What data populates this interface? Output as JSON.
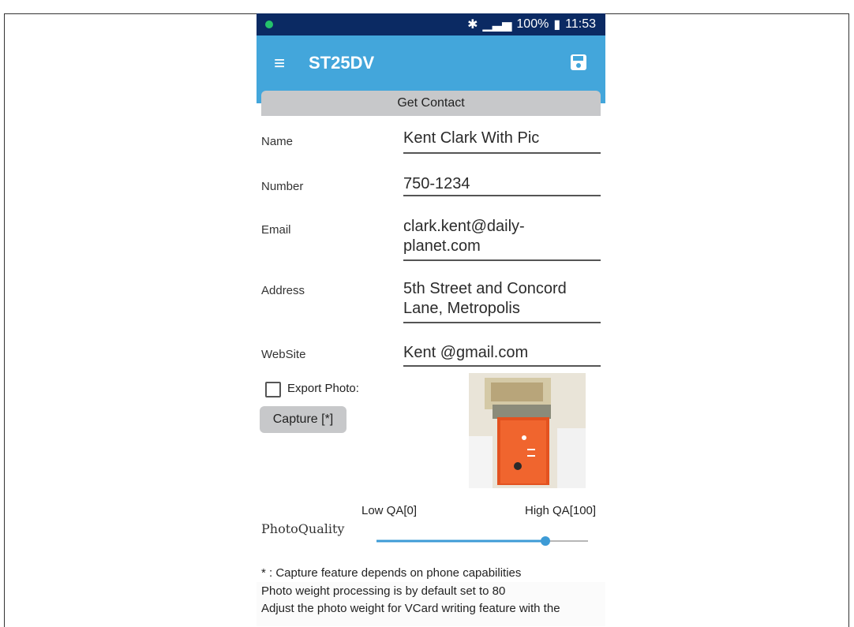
{
  "status_bar": {
    "battery": "100%",
    "time": "11:53"
  },
  "appbar": {
    "title": "ST25DV"
  },
  "get_contact_label": "Get Contact",
  "form": {
    "name_label": "Name",
    "name_value": "Kent Clark With Pic",
    "number_label": "Number",
    "number_value": "750-1234",
    "email_label": "Email",
    "email_value_line1": "clark.kent@daily-",
    "email_value_line2": "planet.com",
    "address_label": "Address",
    "address_value_line1": "5th Street and Concord",
    "address_value_line2": "Lane, Metropolis",
    "website_label": "WebSite",
    "website_value": "Kent @gmail.com"
  },
  "export_photo_label": "Export Photo:",
  "capture_label": "Capture [*]",
  "photo_quality": {
    "low_label": "Low QA[0]",
    "high_label": "High QA[100]",
    "label": "PhotoQuality",
    "value_fraction": 0.8
  },
  "notes": {
    "capture_note": "* : Capture feature depends on phone capabilities",
    "weight_note": "Photo weight processing is by default set to 80",
    "adjust_note": "Adjust the photo weight for VCard writing feature with the"
  },
  "colors": {
    "status_bar": "#0b2a63",
    "app_bar": "#43a6db",
    "slider": "#3d9bd6"
  }
}
